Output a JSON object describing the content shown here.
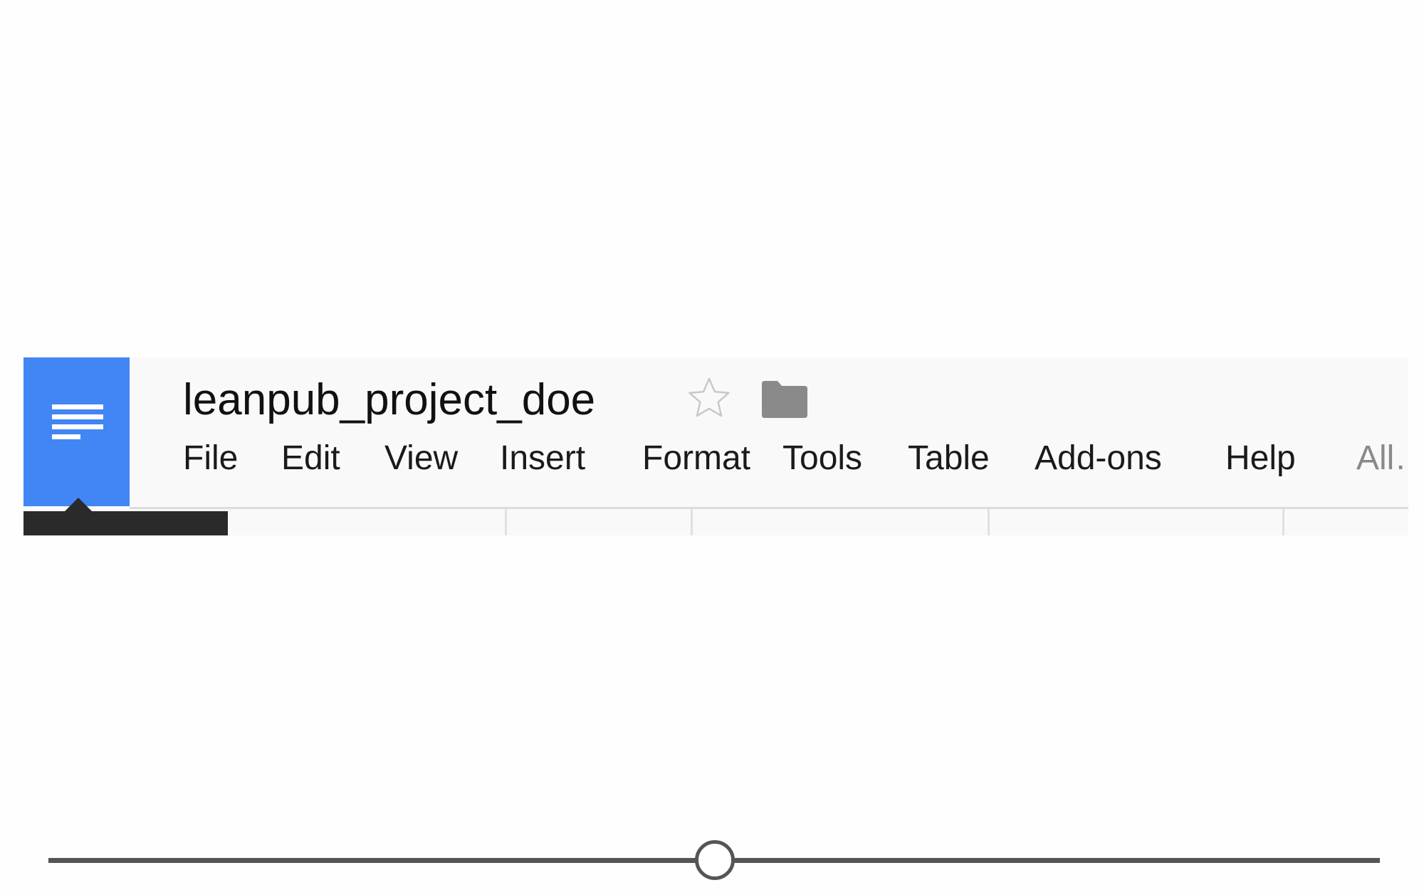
{
  "app": {
    "doc_title": "leanpub_project_doe",
    "logo_icon": "docs-icon",
    "accent_color": "#4285f4"
  },
  "header": {
    "star_icon": "star-outline-icon",
    "folder_icon": "folder-icon"
  },
  "menu": {
    "items": [
      {
        "label": "File"
      },
      {
        "label": "Edit"
      },
      {
        "label": "View"
      },
      {
        "label": "Insert"
      },
      {
        "label": "Format"
      },
      {
        "label": "Tools"
      },
      {
        "label": "Table"
      },
      {
        "label": "Add-ons"
      },
      {
        "label": "Help"
      },
      {
        "label": "All…"
      }
    ]
  },
  "slider": {
    "value": 0.5
  }
}
